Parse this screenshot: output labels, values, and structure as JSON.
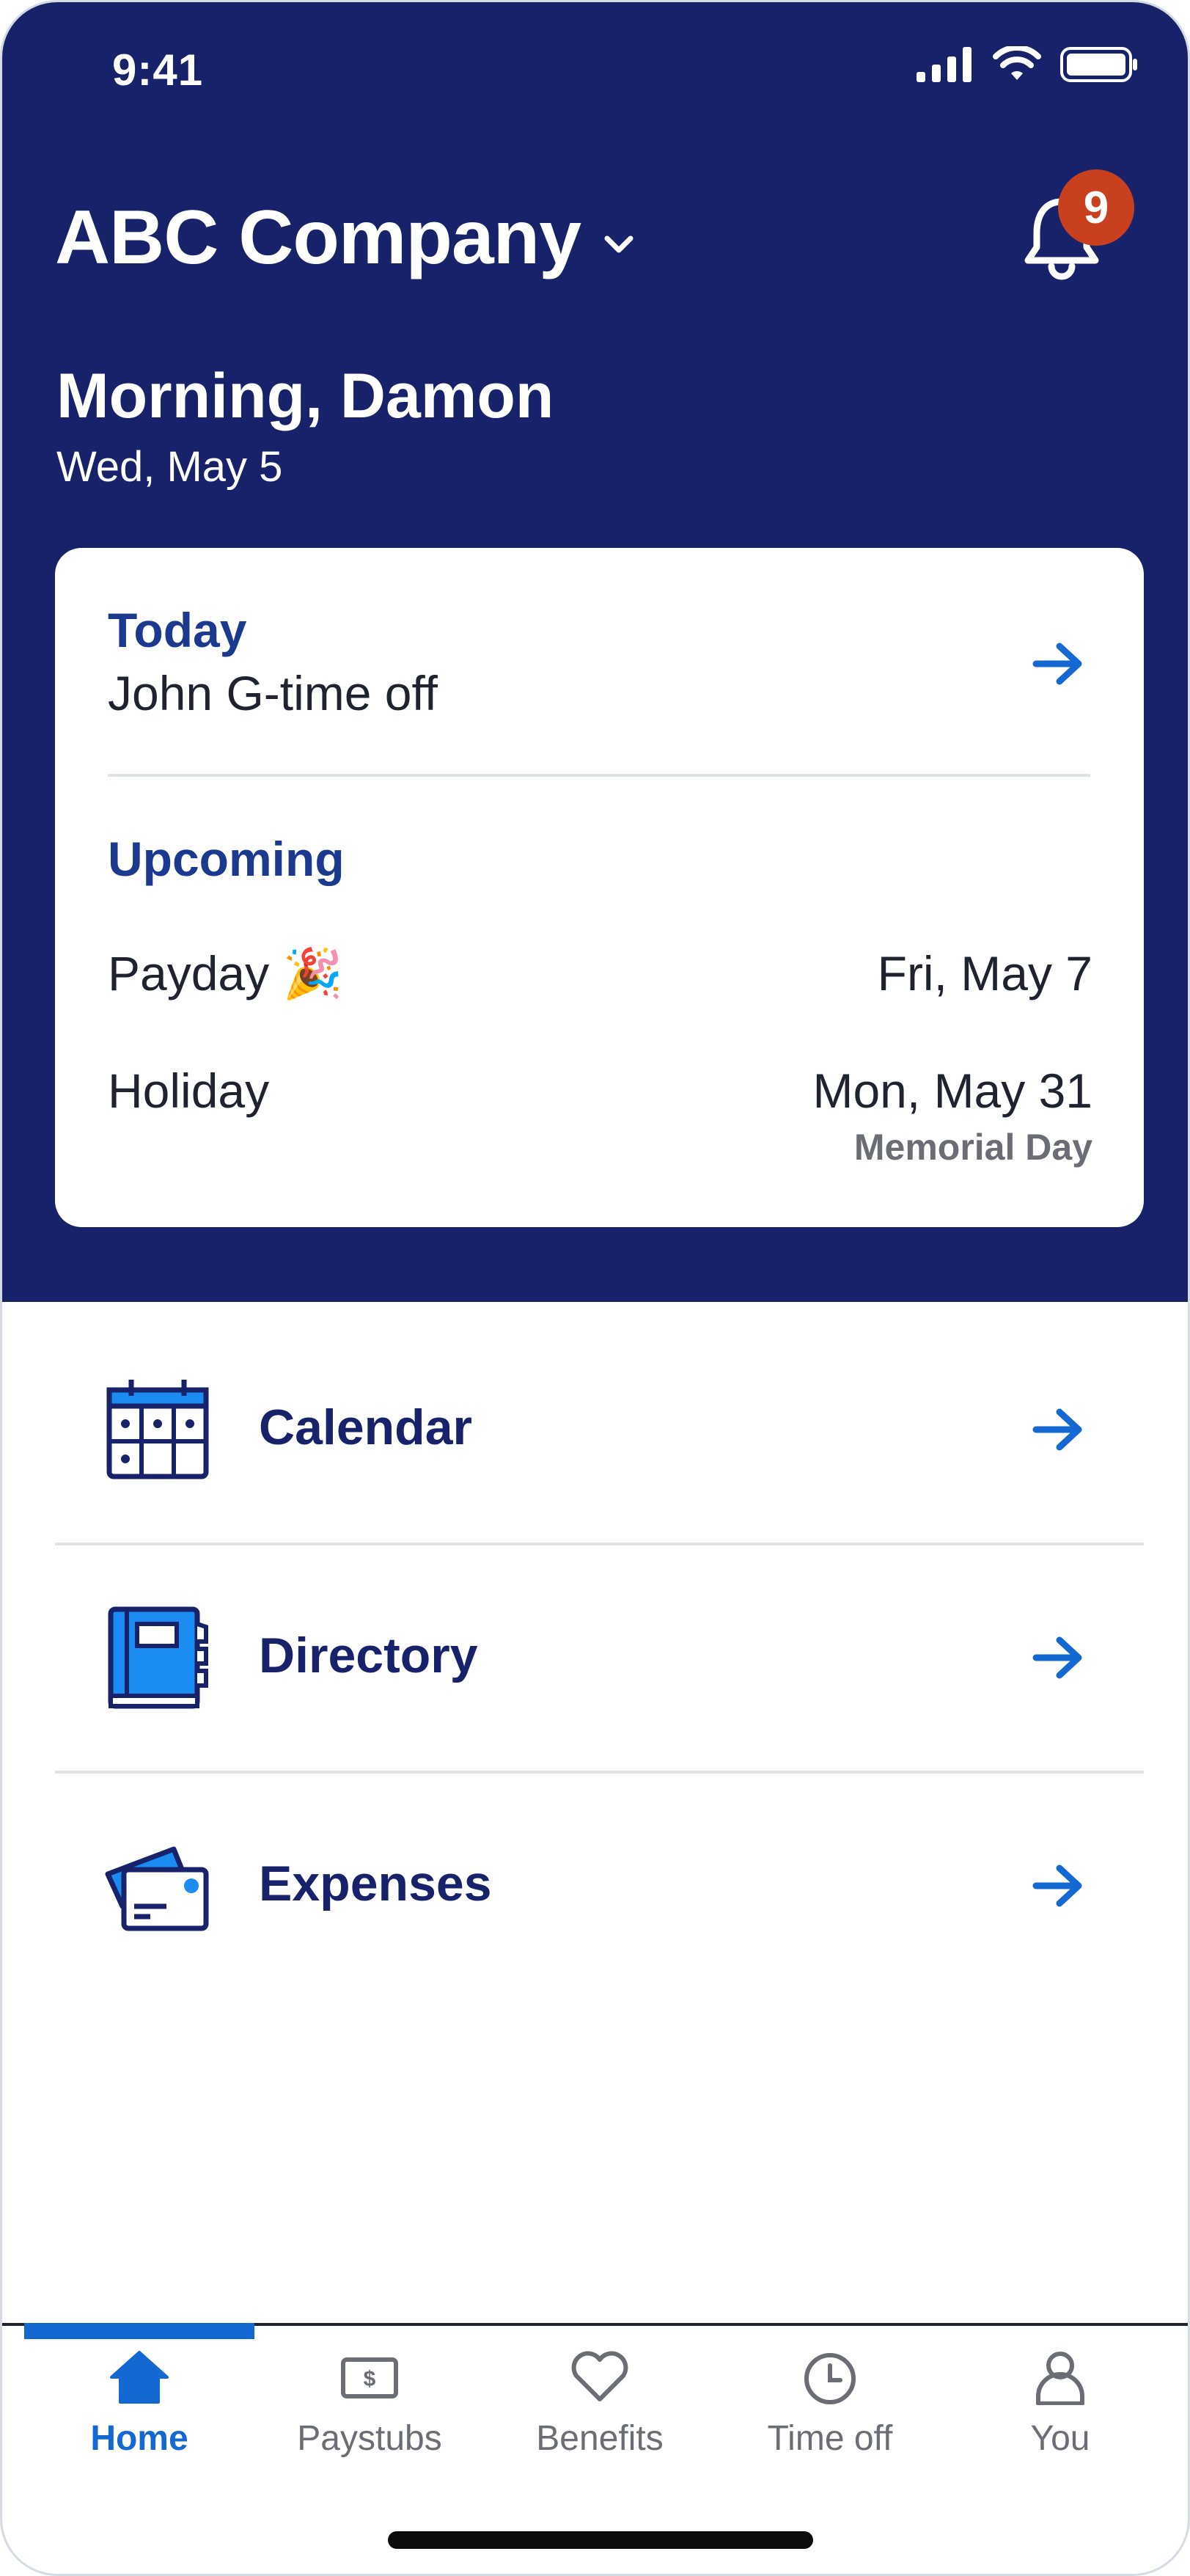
{
  "status_bar": {
    "time": "9:41"
  },
  "header": {
    "company": "ABC Company",
    "notification_count": "9",
    "greeting": "Morning, Damon",
    "date": "Wed, May 5"
  },
  "summary_card": {
    "today_label": "Today",
    "today_item": "John G-time off",
    "upcoming_label": "Upcoming",
    "upcoming": [
      {
        "name": "Payday 🎉",
        "date": "Fri, May 7",
        "note": ""
      },
      {
        "name": "Holiday",
        "date": "Mon, May 31",
        "note": "Memorial Day"
      }
    ]
  },
  "menu": [
    {
      "label": "Calendar",
      "icon": "calendar-icon"
    },
    {
      "label": "Directory",
      "icon": "directory-book-icon"
    },
    {
      "label": "Expenses",
      "icon": "expenses-cards-icon"
    }
  ],
  "tabs": [
    {
      "label": "Home",
      "icon": "home-icon",
      "active": true
    },
    {
      "label": "Paystubs",
      "icon": "paystub-icon",
      "active": false
    },
    {
      "label": "Benefits",
      "icon": "heart-icon",
      "active": false
    },
    {
      "label": "Time off",
      "icon": "clock-icon",
      "active": false
    },
    {
      "label": "You",
      "icon": "person-icon",
      "active": false
    }
  ],
  "colors": {
    "header_bg": "#17226b",
    "accent_blue": "#1468d1",
    "label_blue": "#1b3a8f",
    "badge_red": "#c8401d"
  }
}
